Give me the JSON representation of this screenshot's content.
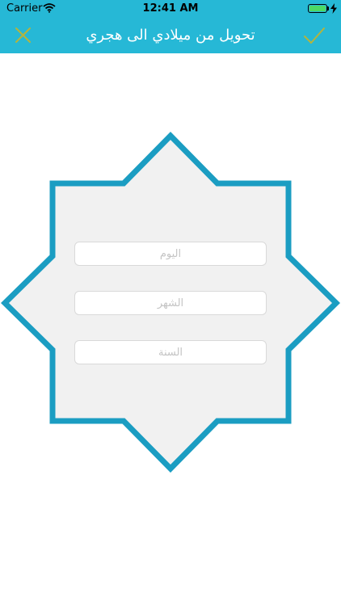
{
  "status_bar": {
    "carrier": "Carrier",
    "time": "12:41 AM"
  },
  "nav": {
    "title": "تحويل من ميلادي الى هجري",
    "close_icon": "close-x-icon",
    "confirm_icon": "checkmark-icon"
  },
  "form": {
    "day": {
      "value": "",
      "placeholder": "اليوم"
    },
    "month": {
      "value": "",
      "placeholder": "الشهر"
    },
    "year": {
      "value": "",
      "placeholder": "السنة"
    }
  },
  "colors": {
    "header": "#26b8d6",
    "icon_accent": "#b5b43c",
    "star_border": "#1b9dc2",
    "star_fill": "#f1f1f1"
  }
}
